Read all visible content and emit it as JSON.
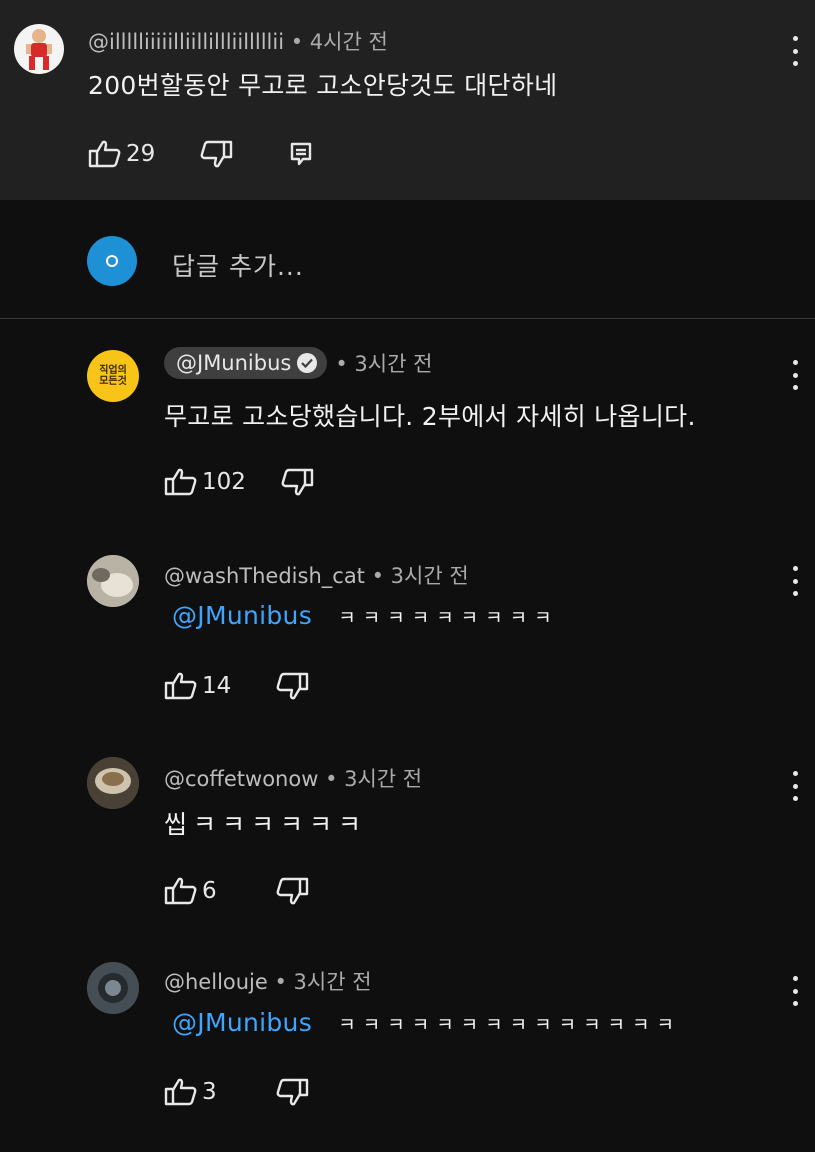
{
  "top_comment": {
    "handle": "@illllliiiiilliillillliilllllii",
    "time": "• 4시간 전",
    "text": "200번할동안 무고로 고소안당것도 대단하네",
    "likes": "29"
  },
  "reply_input": {
    "placeholder": "답글 추가..."
  },
  "replies": [
    {
      "handle": "@JMunibus",
      "verified": true,
      "time": "• 3시간 전",
      "avatar_text": "직업의 모든것",
      "mention": "",
      "text": "무고로 고소당했습니다. 2부에서 자세히 나옵니다.",
      "likes": "102"
    },
    {
      "handle": "@washThedish_cat",
      "time": "• 3시간 전",
      "mention": "@JMunibus",
      "text": "ㅋㅋㅋㅋㅋㅋㅋㅋㅋ",
      "likes": "14"
    },
    {
      "handle": "@coffetwonow",
      "time": "• 3시간 전",
      "mention": "",
      "text": "씹ㅋㅋㅋㅋㅋㅋ",
      "likes": "6"
    },
    {
      "handle": "@hellouje",
      "time": "• 3시간 전",
      "mention": "@JMunibus",
      "text": "ㅋㅋㅋㅋㅋㅋㅋㅋㅋㅋㅋㅋㅋㅋ",
      "likes": "3"
    }
  ],
  "colors": {
    "background": "#0f0f0f",
    "top_comment_bg": "#212121",
    "mention": "#3ea6ff",
    "reply_avatar": "#1e90d6"
  },
  "icons": [
    "like-icon",
    "dislike-icon",
    "reply-icon",
    "more-icon",
    "verified-icon"
  ]
}
